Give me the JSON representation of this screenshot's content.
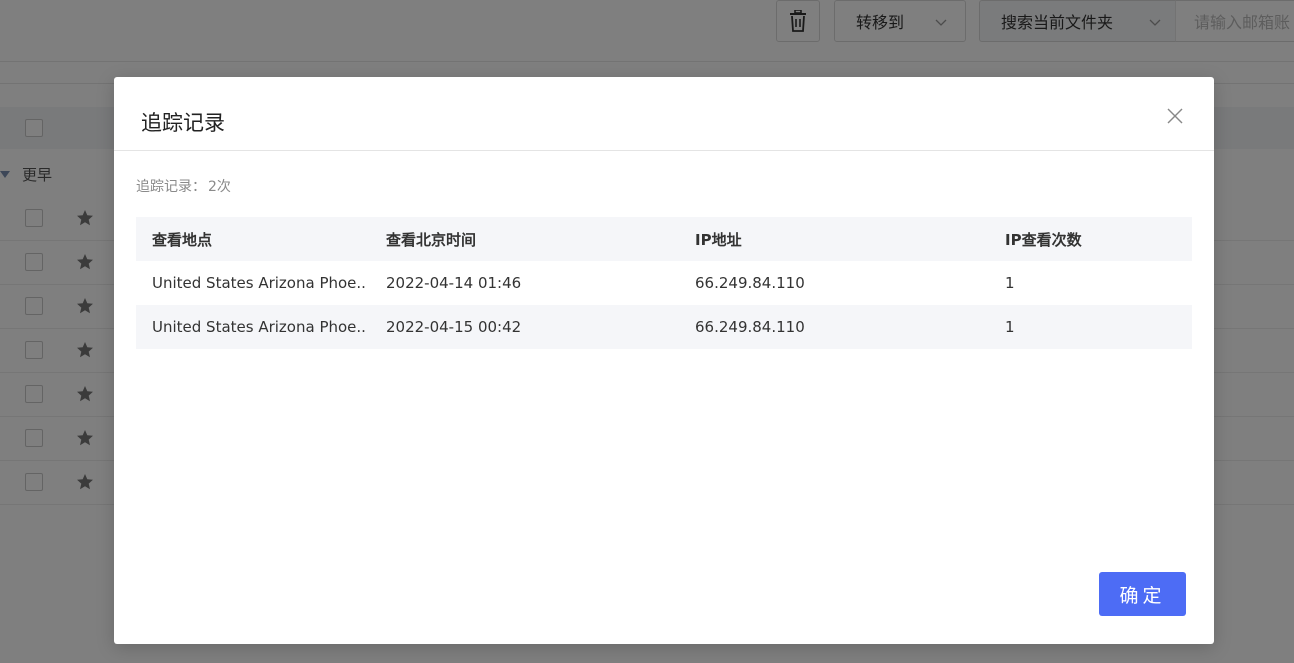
{
  "background": {
    "toolbar": {
      "delete_icon": "trash-icon",
      "move_label": "转移到",
      "scope_label": "搜索当前文件夹",
      "search_placeholder": "请输入邮箱账"
    },
    "group_label": "更早",
    "rows_count_visible": 7
  },
  "modal": {
    "title": "追踪记录",
    "close_icon": "close-icon",
    "count_label": "追踪记录：",
    "count_value": "2次",
    "table": {
      "headers": [
        "查看地点",
        "查看北京时间",
        "IP地址",
        "IP查看次数"
      ],
      "rows": [
        [
          "United States Arizona Phoe..",
          "2022-04-14 01:46",
          "66.249.84.110",
          "1"
        ],
        [
          "United States Arizona Phoe..",
          "2022-04-15 00:42",
          "66.249.84.110",
          "1"
        ]
      ]
    },
    "confirm_label": "确定"
  },
  "colors": {
    "primary": "#4d6cf5",
    "overlay": "rgba(0,0,0,0.5)",
    "table_header_bg": "#f5f6f9"
  }
}
